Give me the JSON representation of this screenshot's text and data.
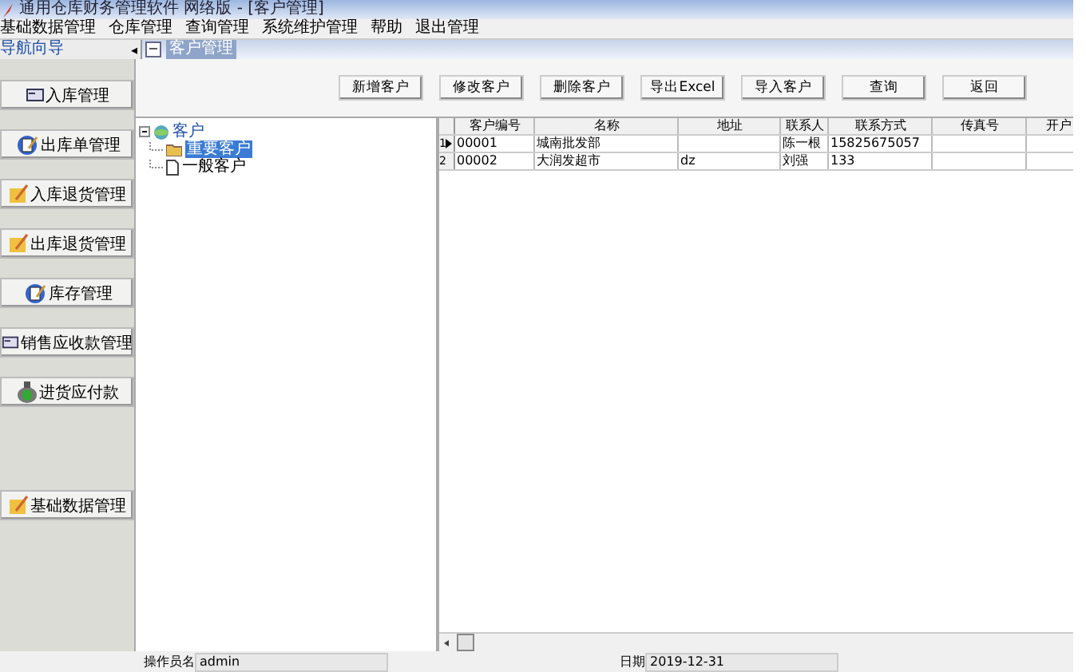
{
  "window": {
    "title": "通用仓库财务管理软件  网络版 - [客户管理]"
  },
  "menu": [
    "基础数据管理",
    "仓库管理",
    "查询管理",
    "系统维护管理",
    "帮助",
    "退出管理"
  ],
  "nav_header": {
    "title": "导航向导",
    "collapse": "◂"
  },
  "panel_header": {
    "toggle": "−",
    "title": "客户管理"
  },
  "sidebar": [
    {
      "label": "入库管理",
      "kind": "card"
    },
    {
      "label": "出库单管理",
      "kind": "book"
    },
    {
      "label": "入库退货管理",
      "kind": "folder"
    },
    {
      "label": "出库退货管理",
      "kind": "folder"
    },
    {
      "label": "库存管理",
      "kind": "book"
    },
    {
      "label": "销售应收款管理",
      "kind": "card"
    },
    {
      "label": "进货应付款",
      "kind": "money"
    },
    {
      "label": "基础数据管理",
      "kind": "folder"
    }
  ],
  "toolbar": [
    "新增客户",
    "修改客户",
    "删除客户",
    "导出Excel",
    "导入客户",
    "查询",
    "返回"
  ],
  "tree": {
    "label": "客户",
    "expanded": true,
    "children": [
      {
        "label": "重要客户",
        "kind": "folder",
        "selected": true
      },
      {
        "label": "一般客户",
        "kind": "page",
        "selected": false
      }
    ]
  },
  "table": {
    "columns": [
      "客户编号",
      "名称",
      "地址",
      "联系人",
      "联系方式",
      "传真号",
      "开户"
    ],
    "rows": [
      {
        "number": "1",
        "current": true,
        "cells": [
          "00001",
          "城南批发部",
          "",
          "陈一根",
          "15825675057",
          "",
          ""
        ]
      },
      {
        "number": "2",
        "current": false,
        "cells": [
          "00002",
          "大润发超市",
          "dz",
          "刘强",
          "133",
          "",
          ""
        ]
      }
    ]
  },
  "status_bar": {
    "operator_label": "操作员名",
    "operator": "admin",
    "date_label": "日期",
    "date": "2019-12-31"
  }
}
